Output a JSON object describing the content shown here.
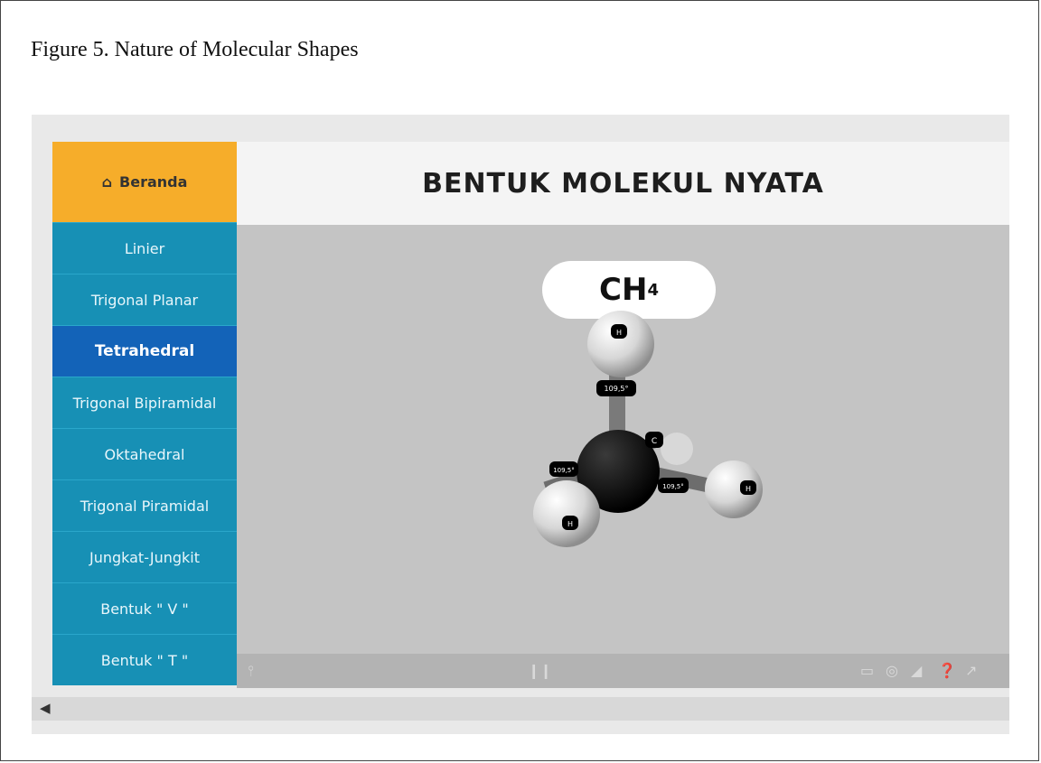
{
  "caption": "Figure 5. Nature of Molecular Shapes",
  "home": {
    "label": "Beranda"
  },
  "menu": [
    "Linier",
    "Trigonal Planar",
    "Tetrahedral",
    "Trigonal Bipiramidal",
    "Oktahedral",
    "Trigonal Piramidal",
    "Jungkat-Jungkit",
    "Bentuk \" V \"",
    "Bentuk \" T \""
  ],
  "active_index": 2,
  "title": "BENTUK MOLEKUL NYATA",
  "formula": {
    "base": "CH",
    "sub": "4"
  },
  "angle_label": "109,5°",
  "atom_labels": {
    "central": "C",
    "outer": "H"
  },
  "colors": {
    "home": "#f6ad2a",
    "menu": "#1790b5",
    "menu_active": "#1363b8",
    "stage": "#c4c4c4"
  },
  "icons": [
    "home-icon",
    "share-icon",
    "pause-icon",
    "screen-icon",
    "vr-icon",
    "fullscreen-icon",
    "help-icon",
    "expand-icon",
    "speaker-icon"
  ]
}
